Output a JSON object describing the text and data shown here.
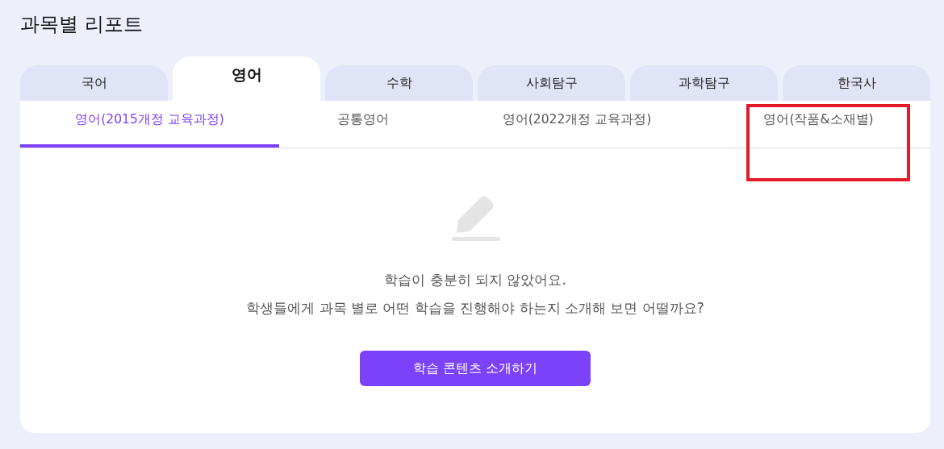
{
  "page_title": "과목별 리포트",
  "subject_tabs": [
    {
      "label": "국어",
      "selected": false
    },
    {
      "label": "영어",
      "selected": true
    },
    {
      "label": "수학",
      "selected": false
    },
    {
      "label": "사회탐구",
      "selected": false
    },
    {
      "label": "과학탐구",
      "selected": false
    },
    {
      "label": "한국사",
      "selected": false
    }
  ],
  "course_tabs": [
    {
      "label": "영어(2015개정 교육과정)",
      "selected": true,
      "highlighted": false
    },
    {
      "label": "공통영어",
      "selected": false,
      "highlighted": false
    },
    {
      "label": "영어(2022개정 교육과정)",
      "selected": false,
      "highlighted": false
    },
    {
      "label": "영어(작품&소재별)",
      "selected": false,
      "highlighted": true
    }
  ],
  "empty_state": {
    "lines": [
      "학습이 충분히 되지 않았어요.",
      "학생들에게 과목 별로 어떤 학습을 진행해야 하는지 소개해 보면 어떨까요?"
    ],
    "button": "학습 콘텐츠 소개하기"
  }
}
